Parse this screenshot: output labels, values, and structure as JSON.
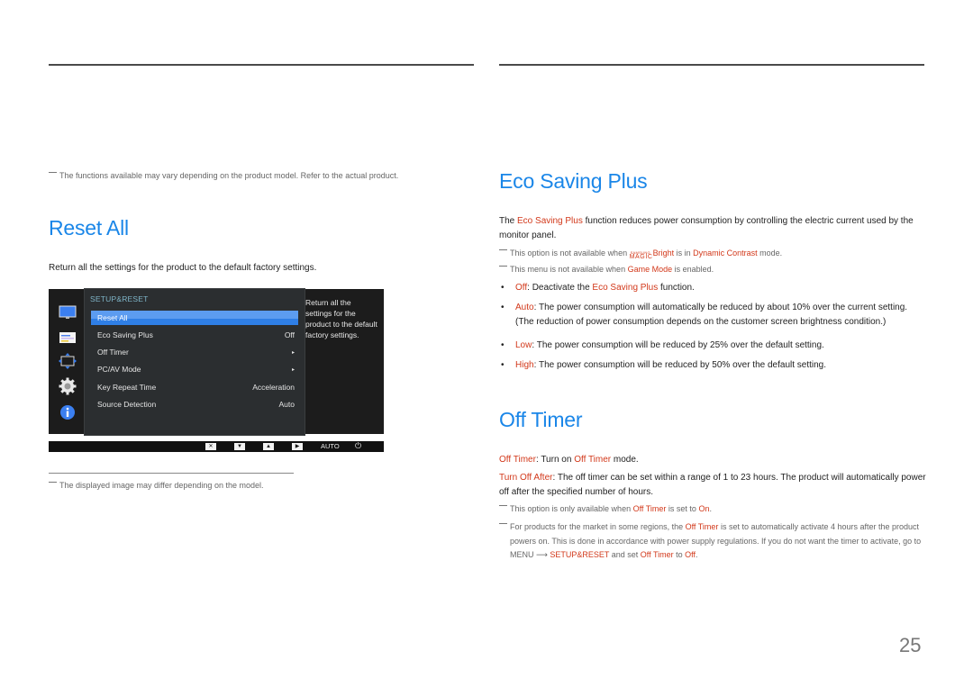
{
  "page_number": "25",
  "colors": {
    "heading": "#1a86e8",
    "highlight": "#d2381a",
    "osd_bg": "#1c1c1c",
    "osd_selected": "#3d8cf0"
  },
  "left": {
    "note_top": "The functions available may vary depending on the product model. Refer to the actual product.",
    "reset_all": {
      "title": "Reset All",
      "description": "Return all the settings for the product to the default factory settings."
    },
    "osd": {
      "menu_title": "SETUP&RESET",
      "side_icons": [
        "monitor-icon",
        "picture-icon",
        "position-icon",
        "gear-icon",
        "info-icon"
      ],
      "items": [
        {
          "label": "Reset All",
          "value": "",
          "selected": true
        },
        {
          "label": "Eco Saving Plus",
          "value": "Off"
        },
        {
          "label": "Off Timer",
          "value": "▸"
        },
        {
          "label": "PC/AV Mode",
          "value": "▸"
        },
        {
          "label": "Key Repeat Time",
          "value": "Acceleration"
        },
        {
          "label": "Source Detection",
          "value": "Auto"
        }
      ],
      "help_text": "Return all the settings for the product to the default factory settings.",
      "bottom_bar": {
        "close": "✕",
        "down": "▼",
        "up": "▲",
        "right": "▶",
        "auto": "AUTO",
        "power": "⏻"
      }
    },
    "note_bottom": "The displayed image may differ depending on the model."
  },
  "right": {
    "eco": {
      "title": "Eco Saving Plus",
      "intro_pre": "The ",
      "intro_hl": "Eco Saving Plus",
      "intro_post": " function reduces power consumption by controlling the electric current used by the monitor panel.",
      "note1_pre": "This option is not available when ",
      "note1_magic_top": "SAMSUNG",
      "note1_magic": "MAGIC",
      "note1_bright": "Bright",
      "note1_mid": " is in ",
      "note1_hl": "Dynamic Contrast",
      "note1_post": " mode.",
      "note2_pre": "This menu is not available when ",
      "note2_hl": "Game Mode",
      "note2_post": " is enabled.",
      "bullets": [
        {
          "key": "Off",
          "pre": ": Deactivate the ",
          "hl": "Eco Saving Plus",
          "post": " function."
        },
        {
          "key": "Auto",
          "text": ": The power consumption will automatically be reduced by about 10% over the current setting. (The reduction of power consumption depends on the customer screen brightness condition.)"
        },
        {
          "key": "Low",
          "text": ": The power consumption will be reduced by 25% over the default setting."
        },
        {
          "key": "High",
          "text": ": The power consumption will be reduced by 50% over the default setting."
        }
      ]
    },
    "off_timer": {
      "title": "Off Timer",
      "line1_hl1": "Off Timer",
      "line1_mid": ": Turn on ",
      "line1_hl2": "Off Timer",
      "line1_post": " mode.",
      "line2_hl": "Turn Off After",
      "line2_text": ": The off timer can be set within a range of 1 to 23 hours. The product will automatically power off after the specified number of hours.",
      "note1_pre": "This option is only available when ",
      "note1_hl1": "Off Timer",
      "note1_mid": " is set to ",
      "note1_hl2": "On",
      "note1_post": ".",
      "note2_pre": "For products for the market in some regions, the ",
      "note2_hl1": "Off Timer",
      "note2_mid1": " is set to automatically activate 4 hours after the product powers on. This is done in accordance with power supply regulations. If you do not want the timer to activate, go to MENU ⟶ ",
      "note2_hl2": "SETUP&RESET",
      "note2_mid2": " and set ",
      "note2_hl3": "Off Timer",
      "note2_mid3": " to ",
      "note2_hl4": "Off",
      "note2_post": "."
    }
  }
}
